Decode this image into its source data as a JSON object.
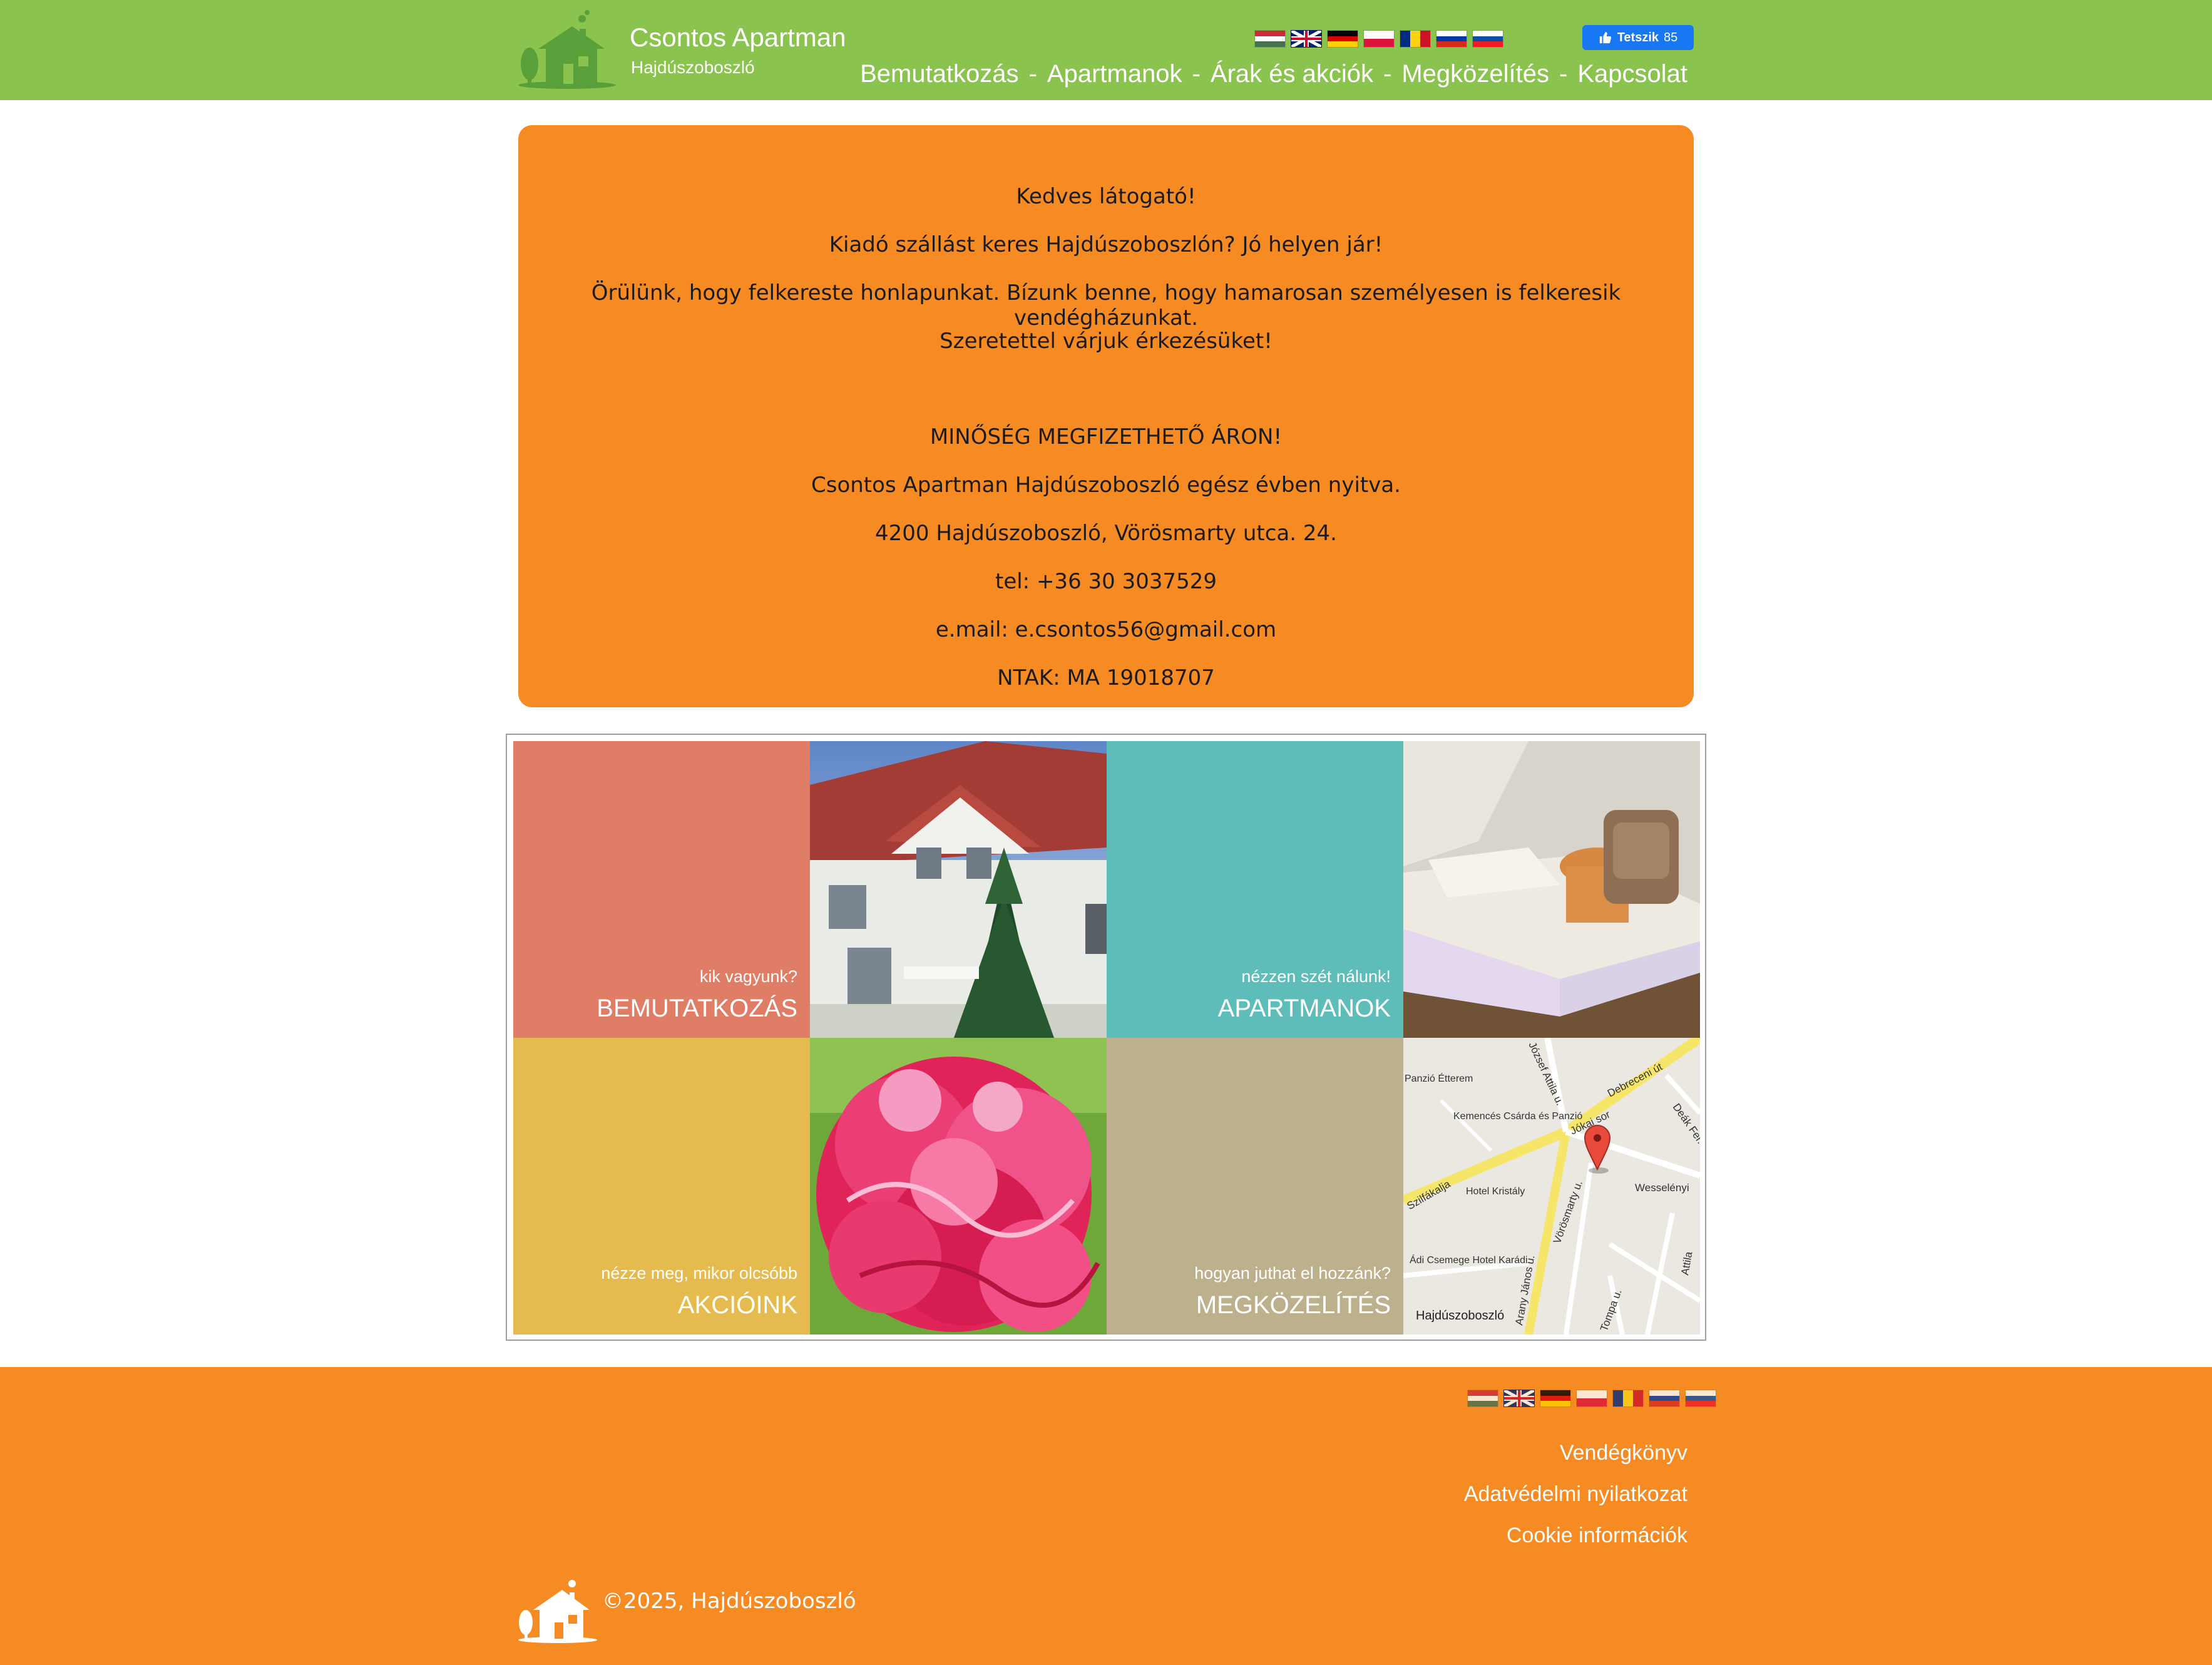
{
  "header": {
    "title": "Csontos Apartman",
    "subtitle": "Hajdúszoboszló",
    "like_button": {
      "label": "Tetszik",
      "count": "85"
    },
    "languages": [
      "hu",
      "en",
      "de",
      "pl",
      "ro",
      "ru",
      "sk"
    ],
    "nav": [
      {
        "label": "Bemutatkozás"
      },
      {
        "label": "Apartmanok"
      },
      {
        "label": "Árak és akciók"
      },
      {
        "label": "Megközelítés"
      },
      {
        "label": "Kapcsolat"
      }
    ],
    "nav_separator": "-"
  },
  "welcome": {
    "greeting": "Kedves látogató!",
    "line1": "Kiadó szállást keres Hajdúszoboszlón? Jó helyen jár!",
    "line2": "Örülünk, hogy felkereste honlapunkat. Bízunk benne, hogy hamarosan személyesen is felkeresik vendégházunkat.",
    "line3": "Szeretettel várjuk érkezésüket!",
    "slogan": "MINŐSÉG MEGFIZETHETŐ ÁRON!",
    "open_info": "Csontos Apartman Hajdúszoboszló egész évben nyitva.",
    "address": "4200 Hajdúszoboszló, Vörösmarty utca. 24.",
    "phone": "tel: +36 30 3037529",
    "email": "e.mail: e.csontos56@gmail.com",
    "ntak": "NTAK: MA 19018707"
  },
  "tiles": [
    {
      "small": "kik vagyunk?",
      "big": "BEMUTATKOZÁS",
      "color": "#e07d66"
    },
    {
      "small": "nézzen szét nálunk!",
      "big": "APARTMANOK",
      "color": "#5ebdb8"
    },
    {
      "small": "nézze meg, mikor olcsóbb",
      "big": "AKCIÓINK",
      "color": "#e5bb50"
    },
    {
      "small": "hogyan juthat el hozzánk?",
      "big": "MEGKÖZELÍTÉS",
      "color": "#bdb18d"
    }
  ],
  "map": {
    "labels": [
      "Jókai sor",
      "Debreceni út",
      "Vörösmarty u.",
      "Arany János u.",
      "Szilfákalja",
      "Wesselényi",
      "Deák Fer.",
      "József Attila u.",
      "Attila",
      "Tompa u.",
      "Kemencés Csárda és Panzió",
      "Hotel Kristály",
      "Ádi Csemege Hotel Karádi",
      "Panzió Étterem",
      "Hajdúszoboszló"
    ]
  },
  "footer": {
    "links": [
      "Vendégkönyv",
      "Adatvédelmi nyilatkozat",
      "Cookie információk"
    ],
    "copyright": "©2025, Hajdúszoboszló"
  },
  "colors": {
    "header_green": "#8bc34f",
    "orange": "#f58b22"
  }
}
